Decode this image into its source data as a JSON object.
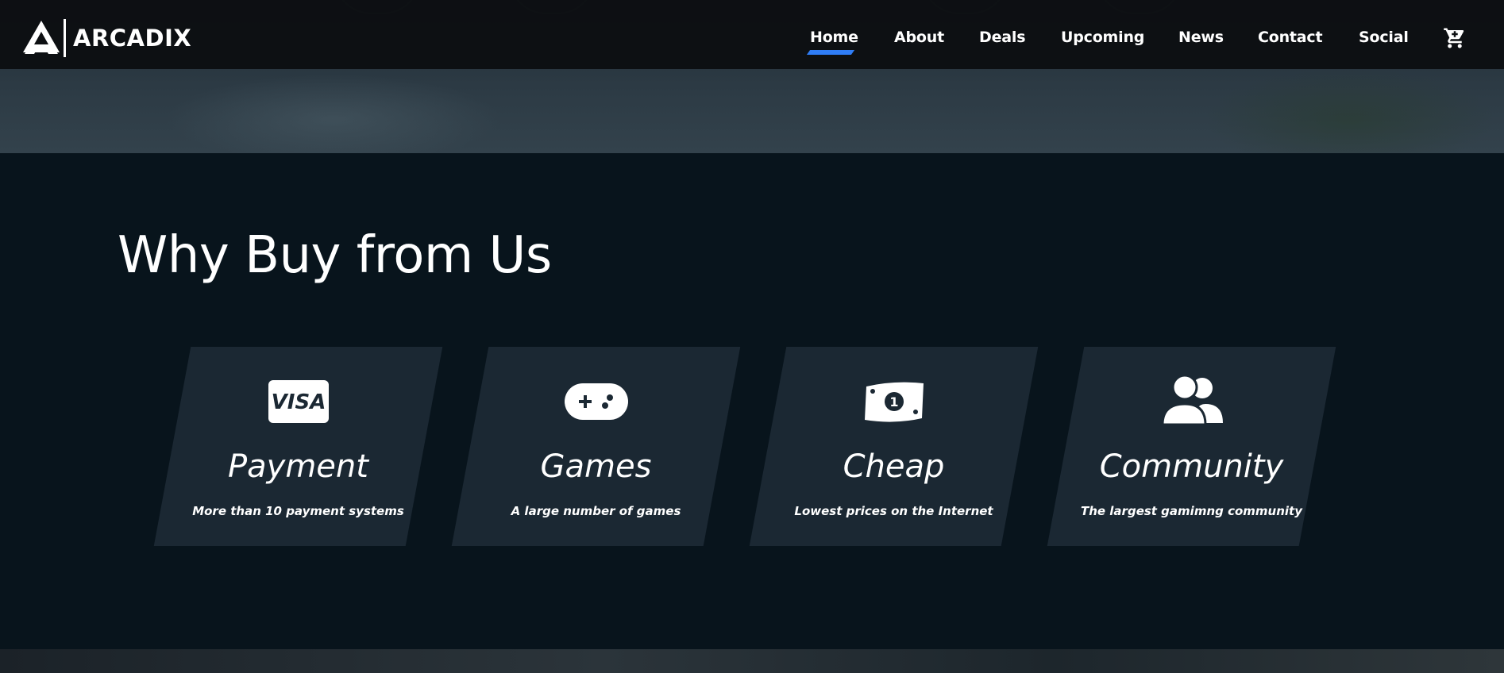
{
  "brand": {
    "name": "ARCADIX"
  },
  "nav": {
    "items": [
      {
        "label": "Home",
        "active": true
      },
      {
        "label": "About",
        "active": false
      },
      {
        "label": "Deals",
        "active": false
      },
      {
        "label": "Upcoming",
        "active": false
      },
      {
        "label": "News",
        "active": false
      },
      {
        "label": "Contact",
        "active": false
      },
      {
        "label": "Social",
        "active": false
      }
    ],
    "cart_icon": "cart-icon"
  },
  "section": {
    "title": "Why Buy from Us",
    "cards": [
      {
        "icon": "visa-icon",
        "title": "Payment",
        "description": "More than 10 payment systems"
      },
      {
        "icon": "gamepad-icon",
        "title": "Games",
        "description": "A large number of games"
      },
      {
        "icon": "money-icon",
        "title": "Cheap",
        "description": "Lowest prices on the Internet"
      },
      {
        "icon": "users-icon",
        "title": "Community",
        "description": "The largest gamimng community"
      }
    ]
  },
  "colors": {
    "accent": "#2f7df6",
    "nav_bg": "#0d0f12",
    "section_bg": "#08141c",
    "card_bg": "#1b2833"
  }
}
